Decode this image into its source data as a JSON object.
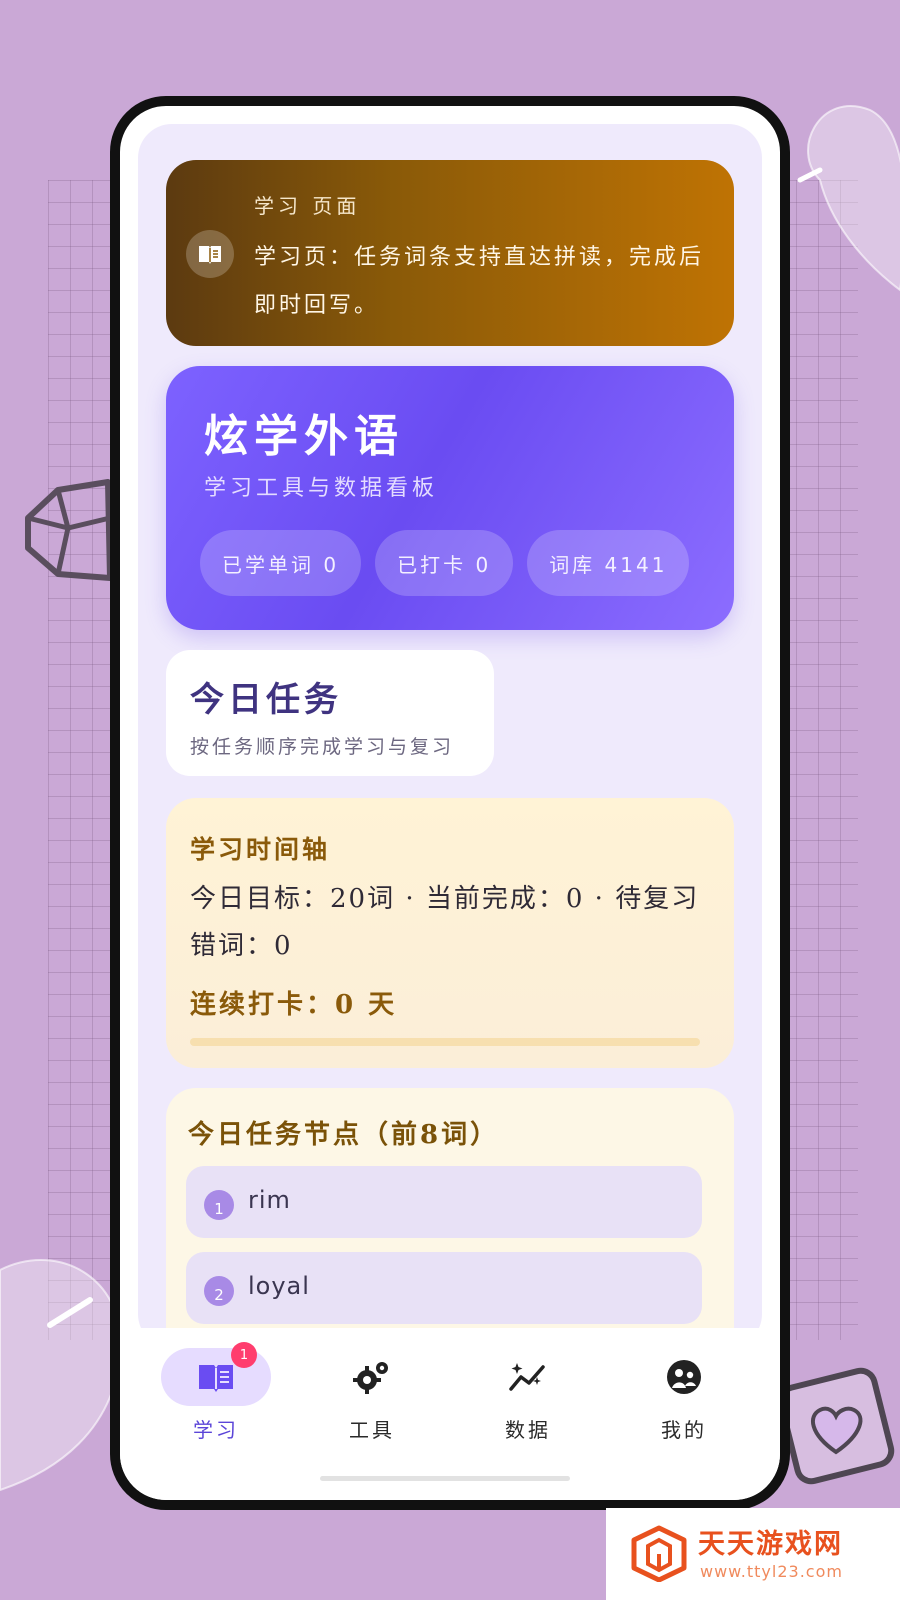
{
  "banner": {
    "title": "学习 页面",
    "text": "学习页：任务词条支持直达拼读，完成后即时回写。",
    "icon": "book-icon"
  },
  "hero": {
    "title": "炫学外语",
    "subtitle": "学习工具与数据看板",
    "stats": [
      "已学单词 0",
      "已打卡 0",
      "词库 4141"
    ]
  },
  "today": {
    "title": "今日任务",
    "subtitle": "按任务顺序完成学习与复习"
  },
  "timeline": {
    "title": "学习时间轴",
    "summary": "今日目标：20词 · 当前完成：0 · 待复习错词：0",
    "streak": "连续打卡：0 天",
    "progress": 0
  },
  "nodes": {
    "title": "今日任务节点（前8词）",
    "items": [
      {
        "num": "1",
        "word": "rim"
      },
      {
        "num": "2",
        "word": "loyal"
      }
    ]
  },
  "nav": {
    "items": [
      {
        "label": "学习",
        "icon": "book-icon",
        "active": true,
        "badge": "1"
      },
      {
        "label": "工具",
        "icon": "gears-icon",
        "active": false
      },
      {
        "label": "数据",
        "icon": "sparkle-chart-icon",
        "active": false
      },
      {
        "label": "我的",
        "icon": "profile-icon",
        "active": false
      }
    ]
  },
  "watermark": {
    "name": "天天游戏网",
    "url": "www.ttyl23.com"
  },
  "colors": {
    "background": "#caa8d6",
    "banner_gradient_start": "#5c3a10",
    "banner_gradient_end": "#bf7304",
    "hero_accent": "#6a4cf2",
    "active_nav": "#5b45d8",
    "badge": "#ff3d6e",
    "timeline_accent": "#8a5a0a"
  }
}
